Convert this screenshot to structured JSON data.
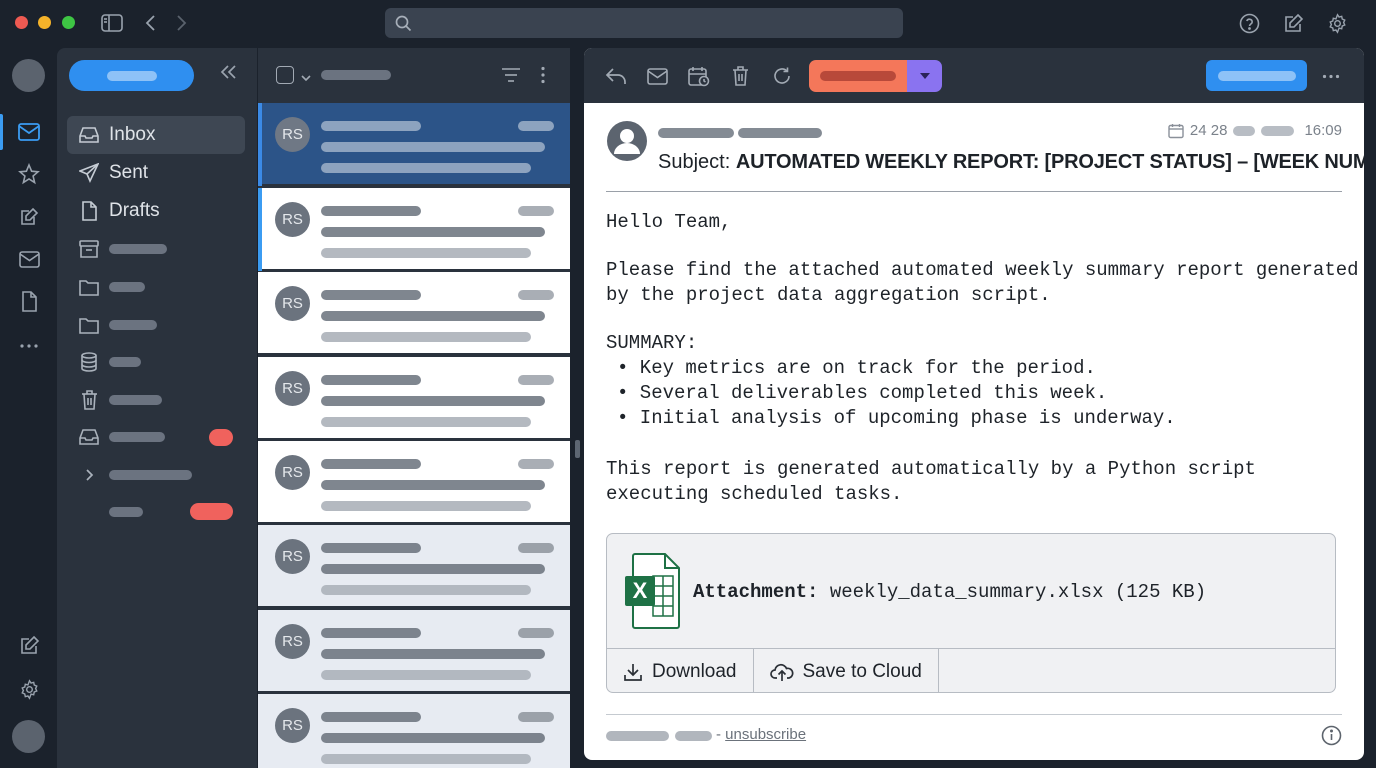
{
  "titlebar": {
    "search_placeholder": "",
    "icons": [
      "sidebar-toggle-icon",
      "back-icon",
      "forward-icon",
      "help-icon",
      "compose-icon",
      "settings-icon"
    ]
  },
  "rail": {
    "icons": [
      "mail-icon",
      "activity-icon",
      "edit-icon",
      "envelope-icon",
      "document-icon",
      "more-icon",
      "compose-icon",
      "settings-icon"
    ]
  },
  "folders": {
    "items": [
      {
        "label": "Inbox",
        "icon": "inbox-icon",
        "active": true
      },
      {
        "label": "Sent",
        "icon": "send-icon"
      },
      {
        "label": "Drafts",
        "icon": "draft-icon"
      }
    ]
  },
  "message_list": {
    "avatar_initials": "RS",
    "count": 8
  },
  "reader": {
    "sender_initial_icon": "user-avatar-icon",
    "date_day": "24 28",
    "time": "16:09",
    "subject_label": "Subject:",
    "subject": "AUTOMATED WEEKLY REPORT: [PROJECT STATUS] – [WEEK NUMBER]",
    "greeting": "Hello Team,",
    "intro_line1": "Please find the attached automated weekly summary report generated",
    "intro_line2": "by the project data aggregation script.",
    "summary_heading": "SUMMARY:",
    "bullets": [
      "• Key metrics are on track for the period.",
      "• Several deliverables completed this week.",
      "• Initial analysis of upcoming phase is underway."
    ],
    "closing_line1": "This report is generated automatically by a Python script",
    "closing_line2": "executing scheduled tasks.",
    "attachment": {
      "label": "Attachment:",
      "filename": "weekly_data_summary.xlsx (125 KB)",
      "icon": "excel-file-icon",
      "download_label": "Download",
      "cloud_label": "Save to Cloud"
    },
    "footer": {
      "separator": "-",
      "unsubscribe": "unsubscribe"
    }
  },
  "colors": {
    "accent_blue": "#2f8ff0",
    "orange": "#f4775a",
    "purple": "#8a73f0",
    "badge_red": "#f0625d",
    "selected_row": "#2c5488",
    "excel_green": "#1e7145"
  }
}
